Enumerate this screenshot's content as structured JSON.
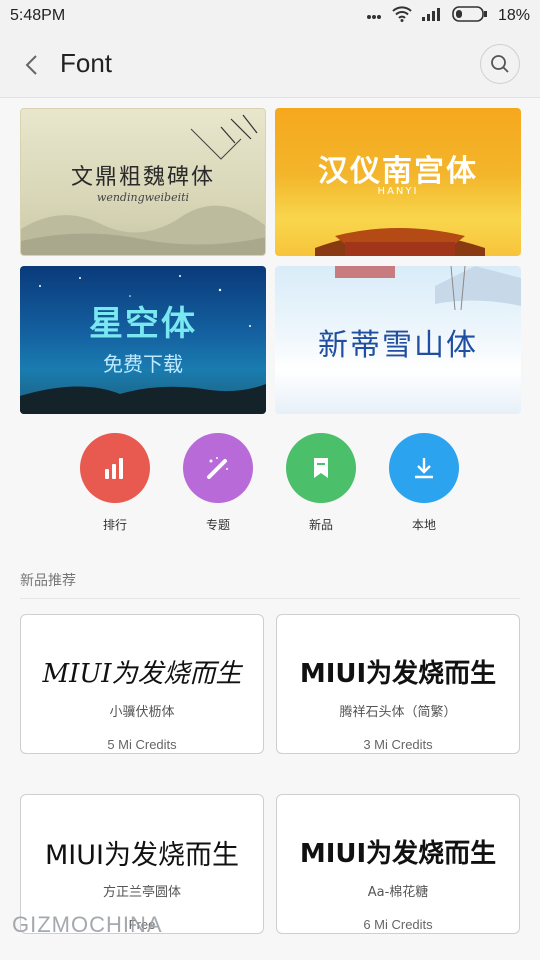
{
  "status": {
    "time": "5:48PM",
    "battery": "18%"
  },
  "header": {
    "title": "Font"
  },
  "banners": [
    {
      "title": "文鼎粗魏碑体",
      "subtitle": "wendingweibeiti"
    },
    {
      "title": "汉仪南宫体",
      "subtitle": "HANYI"
    },
    {
      "title": "星空体",
      "subtitle": "免费下载"
    },
    {
      "title": "新蒂雪山体",
      "subtitle": ""
    }
  ],
  "categories": [
    {
      "label": "排行",
      "color": "#e85a4f",
      "icon": "bar-chart-icon"
    },
    {
      "label": "专题",
      "color": "#b86ad8",
      "icon": "magic-wand-icon"
    },
    {
      "label": "新品",
      "color": "#4cbf6a",
      "icon": "bookmark-icon"
    },
    {
      "label": "本地",
      "color": "#2ba3ee",
      "icon": "download-icon"
    }
  ],
  "section": {
    "title": "新品推荐"
  },
  "fonts": [
    {
      "preview": "MIUI为发烧而生",
      "name": "小骥伏枥体",
      "price": "5 Mi Credits"
    },
    {
      "preview": "MIUI为发烧而生",
      "name": "腾祥石头体（简繁）",
      "price": "3 Mi Credits"
    },
    {
      "preview": "MIUI为发烧而生",
      "name": "方正兰亭圆体",
      "price": "Free"
    },
    {
      "preview": "MIUI为发烧而生",
      "name": "Aa-棉花糖",
      "price": "6 Mi Credits"
    }
  ],
  "watermark": "GIZMOCHINA"
}
